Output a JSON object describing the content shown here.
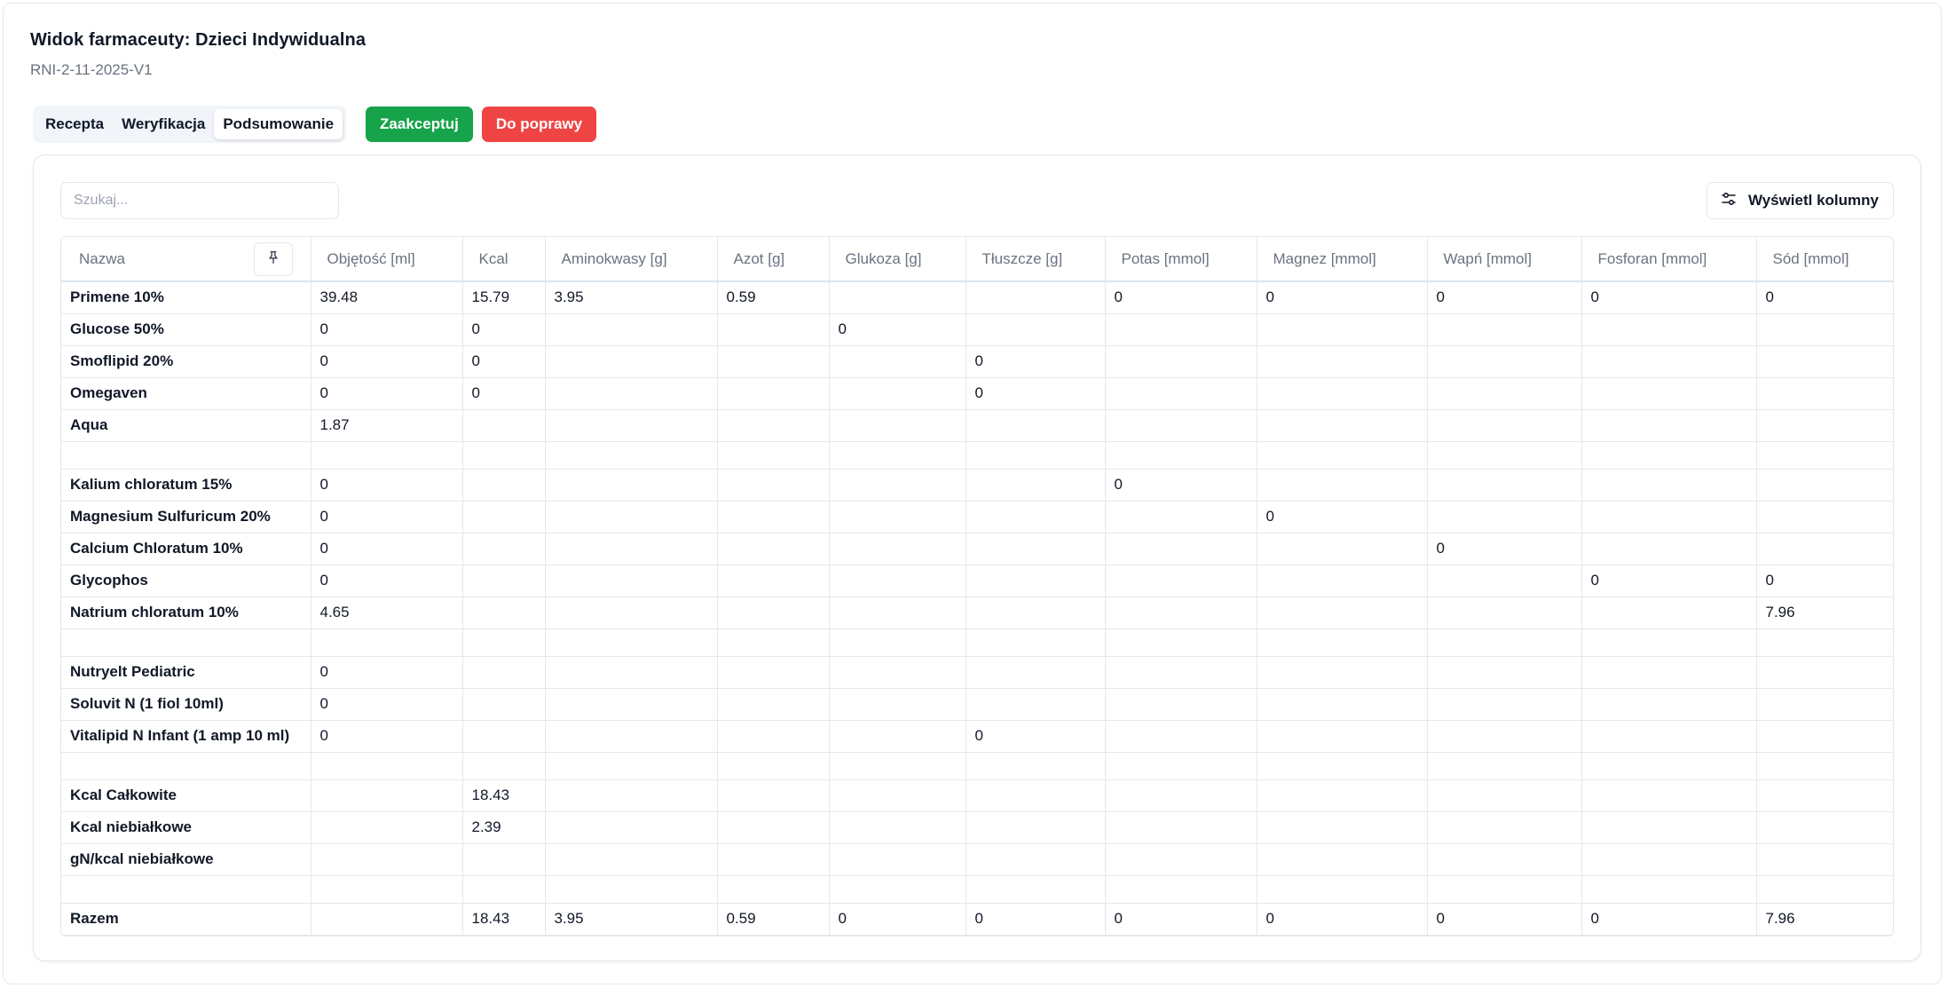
{
  "header": {
    "title": "Widok farmaceuty: Dzieci Indywidualna",
    "subtitle": "RNI-2-11-2025-V1"
  },
  "tabs": [
    {
      "label": "Recepta",
      "active": false
    },
    {
      "label": "Weryfikacja",
      "active": false
    },
    {
      "label": "Podsumowanie",
      "active": true
    }
  ],
  "actions": {
    "accept_label": "Zaakceptuj",
    "reject_label": "Do poprawy"
  },
  "colors": {
    "accept": "#16a34a",
    "reject": "#ef4444"
  },
  "search": {
    "placeholder": "Szukaj..."
  },
  "columns_button": {
    "label": "Wyświetl kolumny",
    "icon": "sliders-icon"
  },
  "table": {
    "pin_icon": "pin-icon",
    "columns": [
      "Nazwa",
      "Objętość [ml]",
      "Kcal",
      "Aminokwasy [g]",
      "Azot [g]",
      "Glukoza [g]",
      "Tłuszcze [g]",
      "Potas [mmol]",
      "Magnez [mmol]",
      "Wapń [mmol]",
      "Fosforan [mmol]",
      "Sód [mmol]"
    ],
    "rows": [
      {
        "type": "data",
        "cells": [
          "Primene 10%",
          "39.48",
          "15.79",
          "3.95",
          "0.59",
          "",
          "",
          "0",
          "0",
          "0",
          "0",
          "0"
        ]
      },
      {
        "type": "data",
        "cells": [
          "Glucose 50%",
          "0",
          "0",
          "",
          "",
          "0",
          "",
          "",
          "",
          "",
          "",
          ""
        ]
      },
      {
        "type": "data",
        "cells": [
          "Smoflipid 20%",
          "0",
          "0",
          "",
          "",
          "",
          "0",
          "",
          "",
          "",
          "",
          ""
        ]
      },
      {
        "type": "data",
        "cells": [
          "Omegaven",
          "0",
          "0",
          "",
          "",
          "",
          "0",
          "",
          "",
          "",
          "",
          ""
        ]
      },
      {
        "type": "data",
        "cells": [
          "Aqua",
          "1.87",
          "",
          "",
          "",
          "",
          "",
          "",
          "",
          "",
          "",
          ""
        ]
      },
      {
        "type": "spacer"
      },
      {
        "type": "data",
        "cells": [
          "Kalium chloratum 15%",
          "0",
          "",
          "",
          "",
          "",
          "",
          "0",
          "",
          "",
          "",
          ""
        ]
      },
      {
        "type": "data",
        "cells": [
          "Magnesium Sulfuricum 20%",
          "0",
          "",
          "",
          "",
          "",
          "",
          "",
          "0",
          "",
          "",
          ""
        ]
      },
      {
        "type": "data",
        "cells": [
          "Calcium Chloratum 10%",
          "0",
          "",
          "",
          "",
          "",
          "",
          "",
          "",
          "0",
          "",
          ""
        ]
      },
      {
        "type": "data",
        "cells": [
          "Glycophos",
          "0",
          "",
          "",
          "",
          "",
          "",
          "",
          "",
          "",
          "0",
          "0"
        ]
      },
      {
        "type": "data",
        "cells": [
          "Natrium chloratum 10%",
          "4.65",
          "",
          "",
          "",
          "",
          "",
          "",
          "",
          "",
          "",
          "7.96"
        ]
      },
      {
        "type": "spacer"
      },
      {
        "type": "data",
        "cells": [
          "Nutryelt Pediatric",
          "0",
          "",
          "",
          "",
          "",
          "",
          "",
          "",
          "",
          "",
          ""
        ]
      },
      {
        "type": "data",
        "cells": [
          "Soluvit N (1 fiol 10ml)",
          "0",
          "",
          "",
          "",
          "",
          "",
          "",
          "",
          "",
          "",
          ""
        ]
      },
      {
        "type": "data",
        "cells": [
          "Vitalipid N Infant (1 amp 10 ml)",
          "0",
          "",
          "",
          "",
          "",
          "0",
          "",
          "",
          "",
          "",
          ""
        ]
      },
      {
        "type": "spacer"
      },
      {
        "type": "data",
        "cells": [
          "Kcal Całkowite",
          "",
          "18.43",
          "",
          "",
          "",
          "",
          "",
          "",
          "",
          "",
          ""
        ]
      },
      {
        "type": "data",
        "cells": [
          "Kcal niebiałkowe",
          "",
          "2.39",
          "",
          "",
          "",
          "",
          "",
          "",
          "",
          "",
          ""
        ]
      },
      {
        "type": "data",
        "cells": [
          "gN/kcal niebiałkowe",
          "",
          "",
          "",
          "",
          "",
          "",
          "",
          "",
          "",
          "",
          ""
        ]
      },
      {
        "type": "spacer"
      },
      {
        "type": "data",
        "cells": [
          "Razem",
          "",
          "18.43",
          "3.95",
          "0.59",
          "0",
          "0",
          "0",
          "0",
          "0",
          "0",
          "7.96"
        ]
      }
    ]
  }
}
